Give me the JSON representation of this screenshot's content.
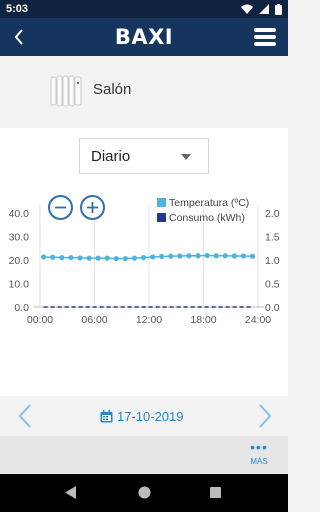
{
  "status_bar": {
    "time": "5:03"
  },
  "app_bar": {
    "logo": "BAXI"
  },
  "device": {
    "name": "Salón"
  },
  "period_select": {
    "value": "Diario"
  },
  "legend": {
    "temperature": "Temperatura (ºC)",
    "consumption": "Consumo (kWh)"
  },
  "colors": {
    "temperature": "#4fb3e1",
    "consumption": "#1f3a8a",
    "accent": "#2589c8",
    "header": "#15345e"
  },
  "chart_data": {
    "type": "line",
    "x_ticks": [
      "00:00",
      "06:00",
      "12:00",
      "18:00",
      "24:00"
    ],
    "y_left_ticks": [
      "0.0",
      "10.0",
      "20.0",
      "30.0",
      "40.0"
    ],
    "y_right_ticks": [
      "0.0",
      "0.5",
      "1.0",
      "1.5",
      "2.0"
    ],
    "ylim_left": [
      0,
      45
    ],
    "ylim_right": [
      0,
      2.25
    ],
    "x_range": [
      0,
      24
    ],
    "grid": "vertical",
    "legend_position": "top-right",
    "series": [
      {
        "name": "Temperatura (ºC)",
        "axis": "left",
        "x": [
          0,
          1,
          2,
          3,
          4,
          5,
          6,
          7,
          8,
          9,
          10,
          11,
          12,
          13,
          14,
          15,
          16,
          17,
          18,
          19,
          20,
          21,
          22,
          23
        ],
        "values": [
          21.3,
          21.2,
          21.0,
          21.0,
          20.9,
          20.8,
          20.8,
          20.8,
          20.6,
          20.6,
          20.8,
          21.0,
          21.3,
          21.5,
          21.6,
          21.7,
          21.8,
          21.8,
          21.9,
          21.8,
          21.8,
          21.7,
          21.7,
          21.6
        ]
      },
      {
        "name": "Consumo (kWh)",
        "axis": "right",
        "x": [
          0,
          1,
          2,
          3,
          4,
          5,
          6,
          7,
          8,
          9,
          10,
          11,
          12,
          13,
          14,
          15,
          16,
          17,
          18,
          19,
          20,
          21,
          22,
          23
        ],
        "values": [
          0,
          0,
          0,
          0,
          0,
          0,
          0,
          0,
          0,
          0,
          0,
          0,
          0,
          0,
          0,
          0,
          0,
          0,
          0,
          0,
          0,
          0,
          0,
          0
        ]
      }
    ]
  },
  "date_nav": {
    "date": "17-10-2019"
  },
  "more": {
    "label": "MÁS"
  }
}
